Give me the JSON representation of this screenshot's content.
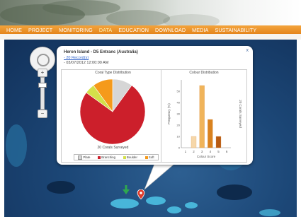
{
  "nav": {
    "items": [
      "HOME",
      "PROJECT",
      "MONITORING",
      "DATA",
      "EDUCATION",
      "DOWNLOAD",
      "MEDIA",
      "SUSTAINABILITY"
    ],
    "active_index": 3
  },
  "popup": {
    "title": "Heron Island - D5 Entranc (Australia)",
    "close": "x",
    "records_link": "- 20 Record(s)",
    "date": "- 03/07/2012 12:00:00 AM"
  },
  "pie_chart": {
    "title": "Coral Type Distribution",
    "caption": "20 Corals Surveyed",
    "legend": [
      "Plate",
      "Branching",
      "Boulder",
      "Soft"
    ]
  },
  "bar_chart": {
    "title": "Colour Distribution",
    "ylabel": "Frequency (%)",
    "xlabel": "Colour Score",
    "right_label": "20 Corals Surveyed",
    "yticks": [
      "0",
      "10",
      "20",
      "30",
      "40",
      "50"
    ],
    "xticks": [
      "1",
      "2",
      "3",
      "4",
      "5",
      "6"
    ]
  },
  "chart_data": [
    {
      "type": "pie",
      "title": "Coral Type Distribution",
      "categories": [
        "Plate",
        "Branching",
        "Boulder",
        "Soft"
      ],
      "values": [
        10,
        75,
        5,
        10
      ],
      "colors": [
        "#d6d6d6",
        "#cc1f2b",
        "#d4e04a",
        "#f59a1b"
      ]
    },
    {
      "type": "bar",
      "title": "Colour Distribution",
      "xlabel": "Colour Score",
      "ylabel": "Frequency (%)",
      "categories": [
        "1",
        "2",
        "3",
        "4",
        "5",
        "6"
      ],
      "values": [
        0,
        10,
        55,
        25,
        10,
        0
      ],
      "ylim": [
        0,
        60
      ],
      "colors": [
        "#f7e3c0",
        "#f6d7aa",
        "#f0b45a",
        "#d9821f",
        "#b85b12",
        "#8a3d0a"
      ]
    }
  ],
  "colors": {
    "nav_orange": "#e5851b",
    "ocean": "#1c4777",
    "pin_red": "#e03a2a",
    "arrow_green": "#2fa84f"
  }
}
